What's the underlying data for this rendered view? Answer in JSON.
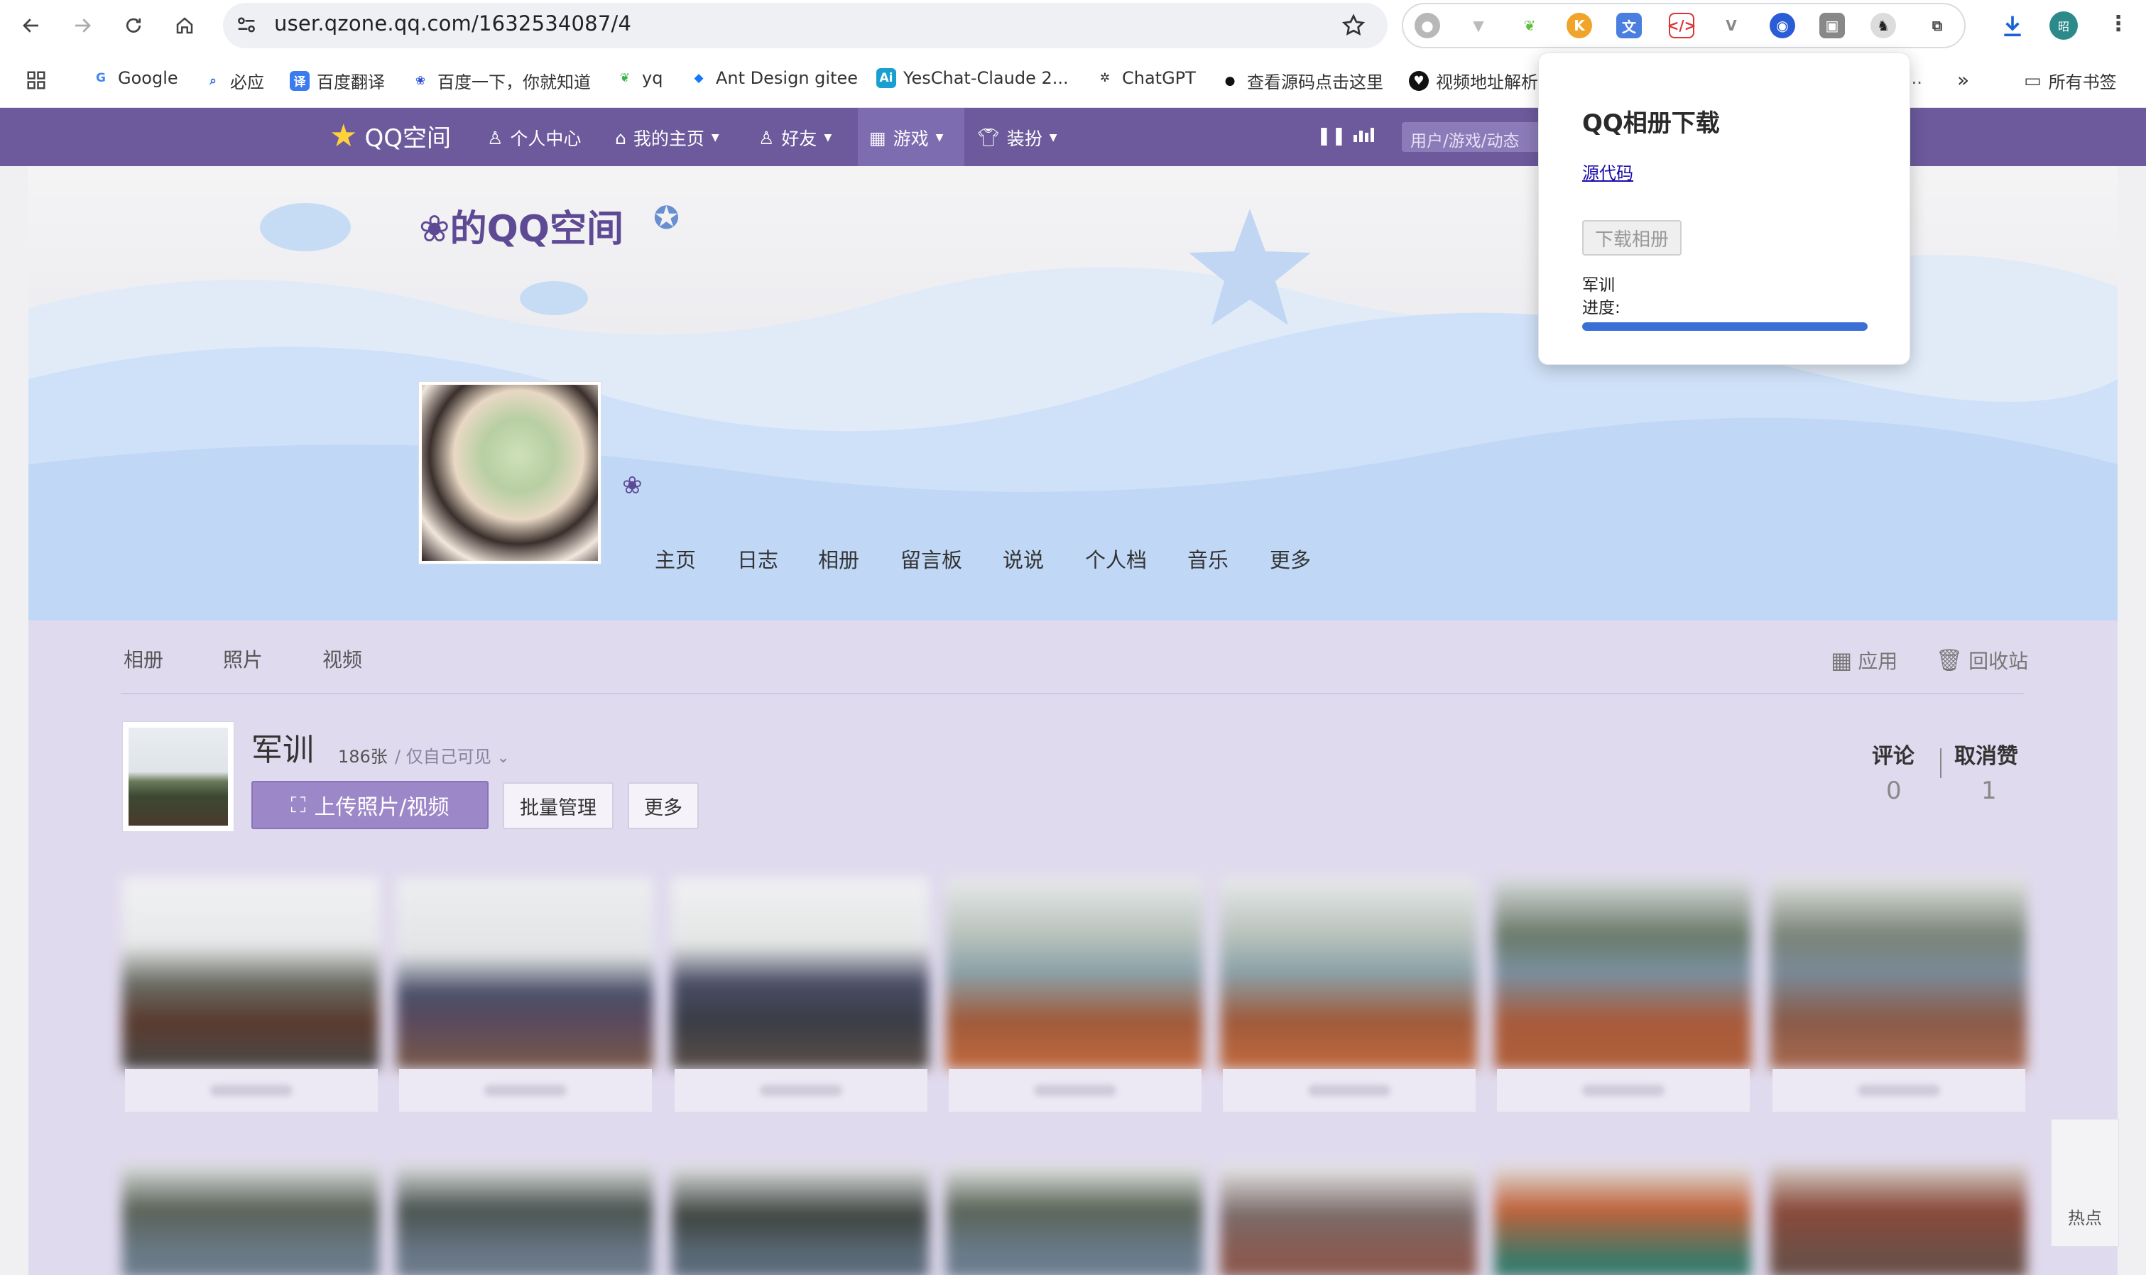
{
  "browser": {
    "url": "user.qzone.qq.com/1632534087/4",
    "profile_initial": "昭"
  },
  "bookmarks": [
    {
      "label": "Google"
    },
    {
      "label": "必应"
    },
    {
      "label": "百度翻译"
    },
    {
      "label": "百度一下，你就知道"
    },
    {
      "label": "yq"
    },
    {
      "label": "Ant Design gitee"
    },
    {
      "label": "YesChat-Claude 2..."
    },
    {
      "label": "ChatGPT"
    },
    {
      "label": "查看源码点击这里"
    },
    {
      "label": "视频地址解析"
    },
    {
      "label": "..."
    },
    {
      "label": "所有书签"
    }
  ],
  "qzone_nav": {
    "logo": "QQ空间",
    "items": [
      {
        "label": "个人中心"
      },
      {
        "label": "我的主页"
      },
      {
        "label": "好友"
      },
      {
        "label": "游戏"
      },
      {
        "label": "装扮"
      }
    ],
    "search_placeholder": "用户/游戏/动态"
  },
  "banner": {
    "space_title": "❀的QQ空间",
    "flower": "❀",
    "subnav": [
      "主页",
      "日志",
      "相册",
      "留言板",
      "说说",
      "个人档",
      "音乐",
      "更多"
    ]
  },
  "album_page": {
    "tabs": [
      "相册",
      "照片",
      "视频"
    ],
    "right_actions": [
      {
        "label": "应用"
      },
      {
        "label": "回收站"
      }
    ],
    "album": {
      "title": "军训",
      "count": "186张",
      "visibility": "/ 仅自己可见"
    },
    "buttons": {
      "upload": "上传照片/视频",
      "batch": "批量管理",
      "more": "更多"
    },
    "stats": [
      {
        "label": "评论",
        "value": "0"
      },
      {
        "label": "取消赞",
        "value": "1"
      }
    ]
  },
  "popup": {
    "title": "QQ相册下载",
    "source_link": "源代码",
    "download_button": "下载相册",
    "album_name": "军训",
    "progress_label": "进度:",
    "progress": 1.0
  },
  "side_widget": {
    "label": "热点"
  }
}
